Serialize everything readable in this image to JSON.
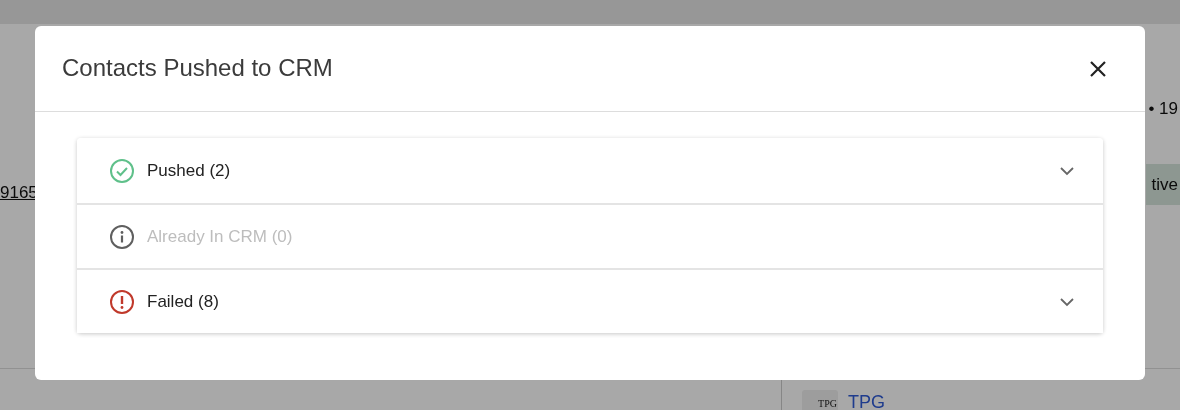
{
  "background": {
    "link_fragment": "9165",
    "meta_fragment": "• 19",
    "status_fragment": "tive",
    "company_logo": "TPG",
    "company_link": "TPG"
  },
  "modal": {
    "title": "Contacts Pushed to CRM",
    "sections": [
      {
        "kind": "success",
        "label": "Pushed (2)",
        "disabled": false
      },
      {
        "kind": "info",
        "label": "Already In CRM (0)",
        "disabled": true
      },
      {
        "kind": "error",
        "label": "Failed (8)",
        "disabled": false
      }
    ]
  }
}
